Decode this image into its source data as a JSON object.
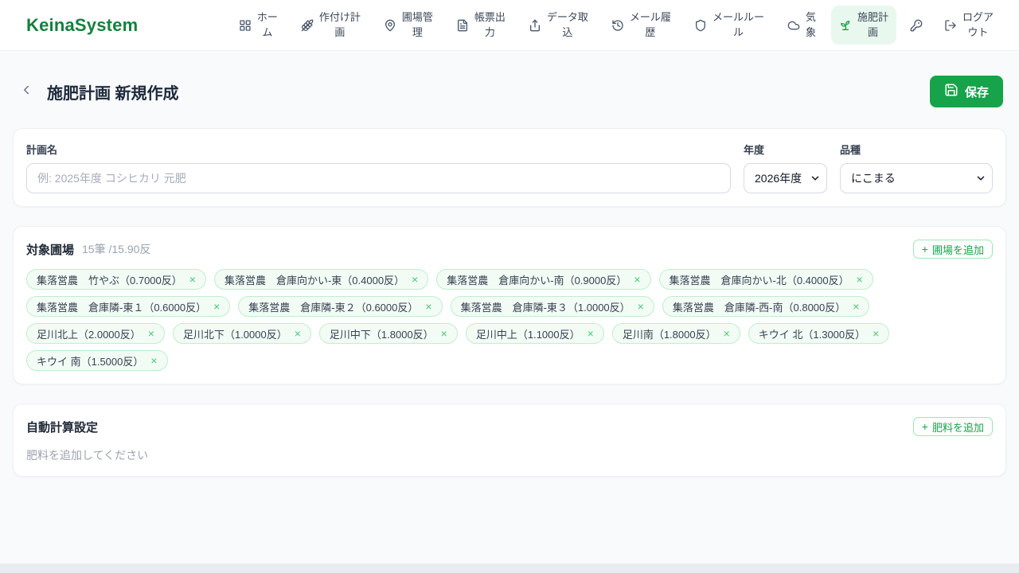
{
  "brand": {
    "name": "KeinaSystem"
  },
  "nav": {
    "items": [
      {
        "label": "ホー\nム",
        "icon": "grid-icon"
      },
      {
        "label": "作付け計\n画",
        "icon": "wheat-icon"
      },
      {
        "label": "圃場管\n理",
        "icon": "map-pin-icon"
      },
      {
        "label": "帳票出\n力",
        "icon": "document-icon"
      },
      {
        "label": "データ取\n込",
        "icon": "upload-icon"
      },
      {
        "label": "メール履\n歴",
        "icon": "history-icon"
      },
      {
        "label": "メールルー\nル",
        "icon": "shield-icon"
      },
      {
        "label": "気\n象",
        "icon": "cloud-icon"
      },
      {
        "label": "施肥計\n画",
        "icon": "sprout-icon"
      },
      {
        "label": "ログア\nウト",
        "icon": "logout-icon"
      }
    ]
  },
  "header": {
    "title": "施肥計画 新規作成",
    "save_label": "保存"
  },
  "form": {
    "plan_name": {
      "label": "計画名",
      "placeholder": "例: 2025年度 コシヒカリ 元肥",
      "value": ""
    },
    "year": {
      "label": "年度",
      "value": "2026年度"
    },
    "variety": {
      "label": "品種",
      "value": "にこまる"
    }
  },
  "fields": {
    "title": "対象圃場",
    "summary": "15筆 /15.90反",
    "add_button": "圃場を追加",
    "chips": [
      {
        "label": "集落営農　竹やぶ（0.7000反）"
      },
      {
        "label": "集落営農　倉庫向かい-東（0.4000反）"
      },
      {
        "label": "集落営農　倉庫向かい-南（0.9000反）"
      },
      {
        "label": "集落営農　倉庫向かい-北（0.4000反）"
      },
      {
        "label": "集落営農　倉庫隣-東１（0.6000反）"
      },
      {
        "label": "集落営農　倉庫隣-東２（0.6000反）"
      },
      {
        "label": "集落営農　倉庫隣-東３（1.0000反）"
      },
      {
        "label": "集落営農　倉庫隣-西-南（0.8000反）"
      },
      {
        "label": "足川北上（2.0000反）"
      },
      {
        "label": "足川北下（1.0000反）"
      },
      {
        "label": "足川中下（1.8000反）"
      },
      {
        "label": "足川中上（1.1000反）"
      },
      {
        "label": "足川南（1.8000反）"
      },
      {
        "label": "キウイ 北（1.3000反）"
      },
      {
        "label": "キウイ 南（1.5000反）"
      }
    ]
  },
  "calc": {
    "title": "自動計算設定",
    "add_button": "肥料を追加",
    "empty_text": "肥料を追加してください"
  },
  "icons": {
    "plus": "+",
    "close": "×"
  },
  "colors": {
    "accent": "#16a34a",
    "accent_light": "#e9f8ef",
    "brand": "#15803d"
  }
}
